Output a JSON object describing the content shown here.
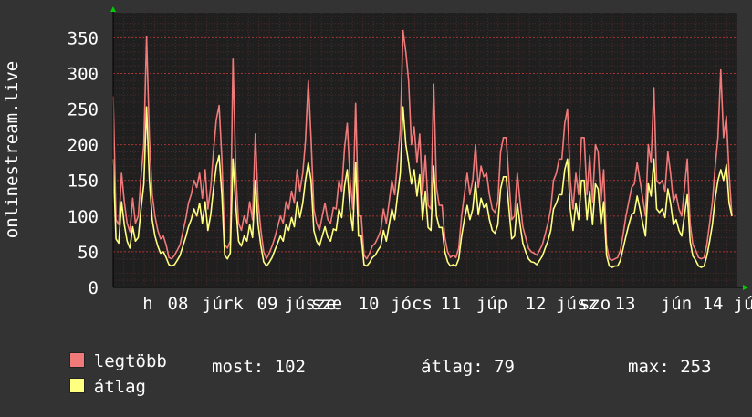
{
  "chart_data": {
    "type": "line",
    "ylabel": "onlinestream.live",
    "yticks": [
      "0",
      "50",
      "100",
      "150",
      "200",
      "250",
      "300",
      "350"
    ],
    "ylim": [
      0,
      385
    ],
    "xtick_labels": [
      "h",
      "08",
      "júrk",
      "09",
      "júsze",
      "sze",
      "10",
      "jócs",
      "11",
      "júp",
      "12",
      "júsz",
      "szo",
      "13",
      "jún",
      "14",
      "jú"
    ],
    "grid": true,
    "colors": {
      "legtobb": "#f07a7a",
      "atlag": "#ffff80",
      "grid": "#aa3333",
      "axis": "#000000"
    },
    "series": [
      {
        "name": "legtöbb",
        "values": [
          268,
          95,
          88,
          160,
          120,
          90,
          78,
          125,
          90,
          100,
          155,
          200,
          352,
          210,
          130,
          100,
          80,
          68,
          72,
          60,
          42,
          40,
          45,
          52,
          60,
          78,
          95,
          118,
          130,
          150,
          140,
          160,
          125,
          165,
          110,
          140,
          190,
          235,
          255,
          180,
          60,
          55,
          65,
          320,
          160,
          90,
          80,
          100,
          90,
          120,
          95,
          215,
          120,
          80,
          50,
          40,
          48,
          58,
          70,
          85,
          100,
          90,
          120,
          110,
          135,
          118,
          165,
          135,
          160,
          205,
          290,
          210,
          110,
          90,
          80,
          100,
          118,
          95,
          90,
          112,
          110,
          150,
          135,
          195,
          230,
          150,
          110,
          258,
          100,
          100,
          45,
          40,
          48,
          58,
          62,
          70,
          80,
          110,
          90,
          120,
          150,
          130,
          175,
          220,
          360,
          330,
          290,
          200,
          225,
          175,
          215,
          130,
          185,
          115,
          110,
          285,
          140,
          115,
          115,
          70,
          50,
          42,
          45,
          42,
          55,
          100,
          130,
          160,
          130,
          150,
          200,
          140,
          170,
          155,
          160,
          130,
          110,
          105,
          120,
          190,
          210,
          210,
          150,
          95,
          100,
          160,
          120,
          85,
          70,
          55,
          50,
          48,
          45,
          52,
          60,
          75,
          90,
          110,
          150,
          160,
          180,
          180,
          230,
          250,
          150,
          110,
          160,
          130,
          210,
          210,
          130,
          185,
          120,
          200,
          190,
          120,
          165,
          60,
          40,
          38,
          40,
          42,
          52,
          75,
          100,
          120,
          140,
          145,
          175,
          150,
          125,
          100,
          200,
          175,
          280,
          150,
          145,
          150,
          135,
          190,
          160,
          120,
          130,
          110,
          100,
          140,
          180,
          90,
          60,
          52,
          42,
          40,
          42,
          60,
          90,
          120,
          170,
          210,
          305,
          210,
          240,
          160,
          100
        ]
      },
      {
        "name": "átlag",
        "values": [
          180,
          68,
          62,
          120,
          88,
          65,
          55,
          85,
          65,
          70,
          110,
          145,
          253,
          150,
          95,
          72,
          58,
          48,
          50,
          42,
          32,
          30,
          32,
          38,
          45,
          58,
          70,
          85,
          95,
          110,
          100,
          118,
          90,
          120,
          80,
          102,
          138,
          170,
          185,
          130,
          45,
          40,
          48,
          180,
          115,
          65,
          58,
          72,
          65,
          88,
          70,
          150,
          88,
          58,
          36,
          30,
          35,
          42,
          52,
          62,
          72,
          65,
          88,
          80,
          98,
          85,
          120,
          98,
          118,
          150,
          175,
          150,
          80,
          65,
          58,
          72,
          85,
          70,
          65,
          82,
          80,
          110,
          98,
          142,
          165,
          108,
          80,
          175,
          72,
          72,
          32,
          30,
          35,
          42,
          45,
          52,
          58,
          80,
          65,
          88,
          110,
          95,
          128,
          160,
          253,
          200,
          175,
          145,
          165,
          128,
          158,
          95,
          135,
          84,
          80,
          170,
          100,
          84,
          84,
          50,
          36,
          30,
          32,
          30,
          40,
          72,
          95,
          115,
          95,
          110,
          148,
          102,
          125,
          112,
          118,
          95,
          80,
          76,
          88,
          138,
          155,
          155,
          110,
          68,
          72,
          118,
          88,
          62,
          50,
          40,
          36,
          35,
          32,
          38,
          44,
          55,
          65,
          80,
          110,
          118,
          130,
          130,
          165,
          180,
          110,
          80,
          118,
          95,
          150,
          150,
          95,
          135,
          88,
          145,
          138,
          88,
          120,
          45,
          30,
          28,
          30,
          30,
          38,
          55,
          72,
          88,
          102,
          105,
          128,
          110,
          90,
          72,
          145,
          128,
          180,
          110,
          105,
          110,
          98,
          138,
          118,
          88,
          95,
          80,
          72,
          102,
          130,
          65,
          44,
          38,
          30,
          28,
          30,
          44,
          65,
          88,
          125,
          150,
          165,
          150,
          172,
          118,
          100
        ]
      }
    ]
  },
  "legend": [
    {
      "label": "legtöbb",
      "color": "#f07a7a"
    },
    {
      "label": "átlag",
      "color": "#ffff80"
    }
  ],
  "stats": {
    "most": "most: 102",
    "atlag": "átlag: 79",
    "max": "max: 253"
  }
}
